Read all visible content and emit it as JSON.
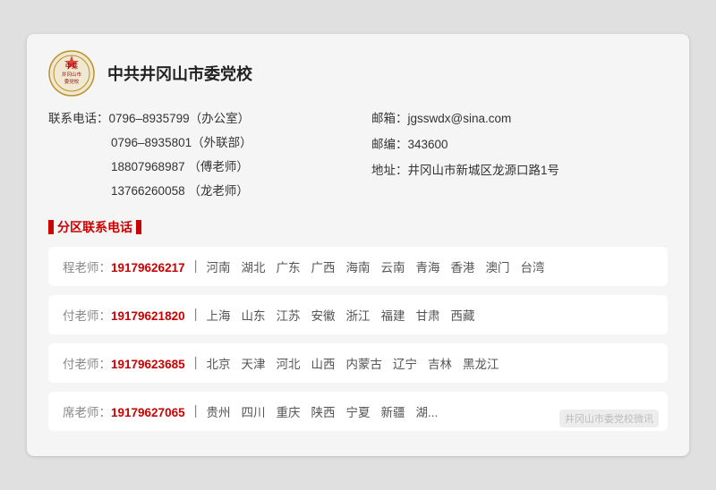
{
  "header": {
    "org_name": "中共井冈山市委党校"
  },
  "contact": {
    "left": [
      {
        "label": "联系电话：",
        "value": "0796–8935799（办公室）"
      },
      {
        "label": "",
        "value": "0796–8935801（外联部）"
      },
      {
        "label": "",
        "value": "18807968987 （傅老师）"
      },
      {
        "label": "",
        "value": "13766260058 （龙老师）"
      }
    ],
    "right": [
      {
        "label": "邮箱：",
        "value": "jgsswdx@sina.com"
      },
      {
        "label": "邮编：",
        "value": "343600"
      },
      {
        "label": "地址：",
        "value": "井冈山市新城区龙源口路1号"
      }
    ]
  },
  "section_title": "分区联系电话",
  "regions": [
    {
      "teacher": "程老师：",
      "phone": "19179626217",
      "areas": [
        "河南",
        "湖北",
        "广东",
        "广西",
        "海南",
        "云南",
        "青海",
        "香港",
        "澳门",
        "台湾"
      ]
    },
    {
      "teacher": "付老师：",
      "phone": "19179621820",
      "areas": [
        "上海",
        "山东",
        "江苏",
        "安徽",
        "浙江",
        "福建",
        "甘肃",
        "西藏"
      ]
    },
    {
      "teacher": "付老师：",
      "phone": "19179623685",
      "areas": [
        "北京",
        "天津",
        "河北",
        "山西",
        "内蒙古",
        "辽宁",
        "吉林",
        "黑龙江"
      ]
    },
    {
      "teacher": "席老师：",
      "phone": "19179627065",
      "areas": [
        "贵州",
        "四川",
        "重庆",
        "陕西",
        "宁夏",
        "新疆",
        "湖..."
      ]
    }
  ],
  "watermark": "井冈山市委党校微讯"
}
